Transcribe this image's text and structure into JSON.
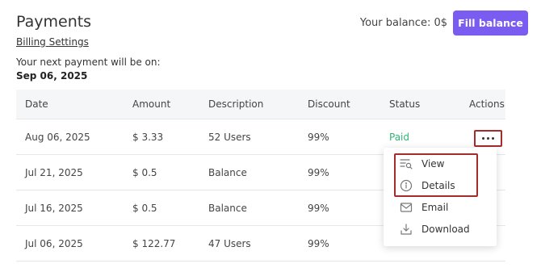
{
  "page": {
    "title": "Payments"
  },
  "billing": {
    "settings_link": "Billing Settings",
    "next_payment_label": "Your next payment will be on:",
    "next_payment_date": "Sep 06, 2025"
  },
  "header": {
    "balance_label": "Your balance: 0$",
    "fill_button": "Fill balance"
  },
  "colors": {
    "accent": "#7b5cf0",
    "paid": "#2fb673",
    "highlight": "#a32c2c"
  },
  "table": {
    "columns": [
      "Date",
      "Amount",
      "Description",
      "Discount",
      "Status",
      "Actions"
    ],
    "rows": [
      {
        "date": "Aug 06, 2025",
        "amount": "$ 3.33",
        "description": "52 Users",
        "discount": "99%",
        "status": "Paid"
      },
      {
        "date": "Jul 21, 2025",
        "amount": "$ 0.5",
        "description": "Balance",
        "discount": "99%",
        "status": ""
      },
      {
        "date": "Jul 16, 2025",
        "amount": "$ 0.5",
        "description": "Balance",
        "discount": "99%",
        "status": ""
      },
      {
        "date": "Jul 06, 2025",
        "amount": "$ 122.77",
        "description": "47 Users",
        "discount": "99%",
        "status": ""
      }
    ]
  },
  "actions_menu": {
    "items": [
      {
        "label": "View",
        "icon": "view-list-icon"
      },
      {
        "label": "Details",
        "icon": "info-icon"
      },
      {
        "label": "Email",
        "icon": "mail-icon"
      },
      {
        "label": "Download",
        "icon": "download-icon"
      }
    ]
  }
}
